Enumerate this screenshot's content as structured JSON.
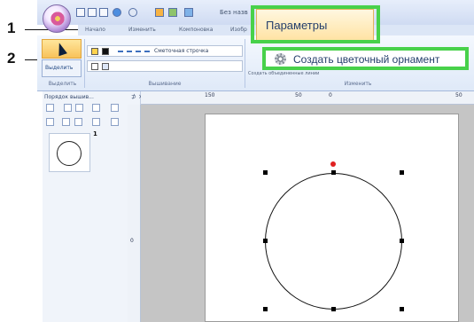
{
  "callouts": [
    "1",
    "2"
  ],
  "quick_access": {
    "title_fragment": "Без назв"
  },
  "ribbon_tabs": [
    "Начало",
    "Изменить",
    "Компоновка",
    "Изобр"
  ],
  "active_tab_label": "Параметры",
  "ribbon": {
    "select_label": "Выделить",
    "stitch_type": "Сметочная строчка",
    "change_option": "Создать объединенные линии",
    "groups": {
      "select": "Выделить",
      "stitching": "Вышивание",
      "change": "Изменить"
    }
  },
  "flower_button_label": "Создать цветочный орнамент",
  "order_pane": {
    "title": "Порядок вышив...",
    "close": "⊅ ×",
    "item_number": "1"
  },
  "ruler": {
    "top_labels": [
      "150",
      "50",
      "0",
      "50"
    ],
    "side_label": "0"
  },
  "colors": {
    "highlight": "#48d14a",
    "rotation_handle": "#e02020",
    "ribbon": "#dfe9f8"
  },
  "icons": [
    "app-orb-icon",
    "flower-pattern-icon",
    "select-arrow-icon",
    "close-icon"
  ]
}
